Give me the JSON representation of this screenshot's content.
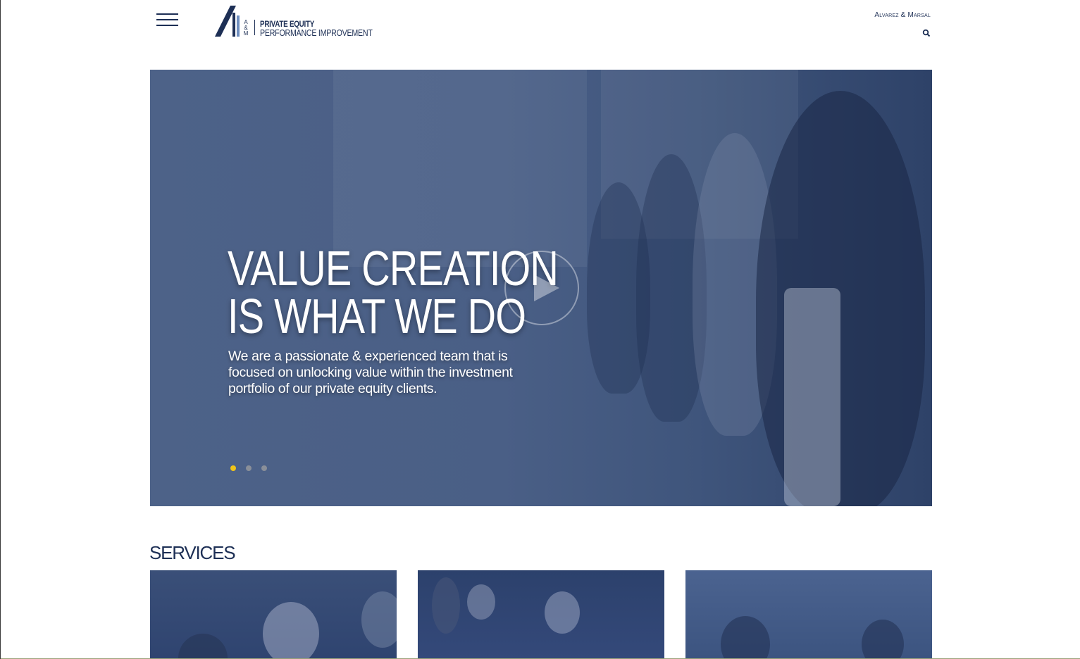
{
  "header": {
    "menu_icon": "hamburger-icon",
    "logo": {
      "mark_letters": "A&M",
      "line1": "PRIVATE EQUITY",
      "line2": "PERFORMANCE IMPROVEMENT"
    },
    "parent_link": "Alvarez & Marsal",
    "search_icon": "search-icon"
  },
  "hero": {
    "title_line1": "VALUE CREATION",
    "title_line2": "IS WHAT WE DO",
    "description": "We are a passionate & experienced team that is focused on unlocking value within the investment portfolio of our private equity clients.",
    "play_icon": "play-icon",
    "slides": {
      "count": 3,
      "active": 1
    },
    "colors": {
      "overlay": "#4a5f86",
      "active_dot": "#f0c419",
      "inactive_dot": "#8a8f99"
    }
  },
  "services": {
    "heading": "SERVICES",
    "cards": 3
  },
  "colors": {
    "brand": "#1d2f55",
    "background": "#ffffff"
  }
}
